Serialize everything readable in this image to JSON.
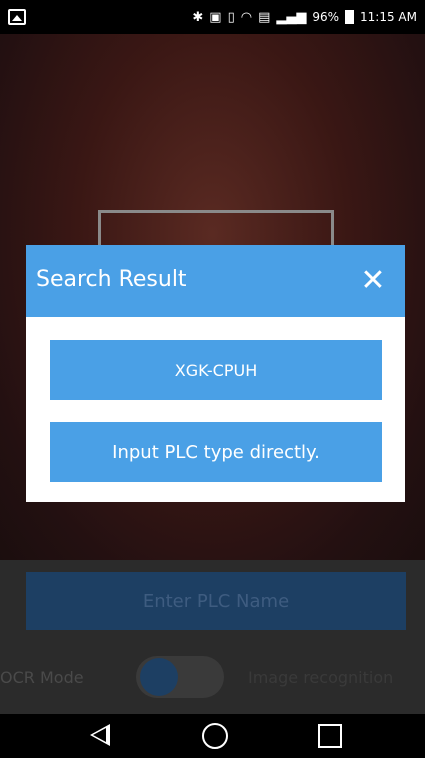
{
  "status_bar": {
    "battery": "96%",
    "time": "11:15 AM",
    "icons": [
      "gallery-icon",
      "bluetooth-icon",
      "nfc-icon",
      "vibrate-icon",
      "wifi-icon",
      "sim-icon",
      "signal-icon",
      "battery-icon"
    ]
  },
  "dialog": {
    "title": "Search Result",
    "close_icon": "close-icon",
    "results": [
      "XGK-CPUH",
      "Input PLC type directly."
    ]
  },
  "background": {
    "enter_button": "Enter PLC Name",
    "ocr_label": "OCR Mode",
    "image_label": "Image recognition"
  },
  "nav_bar": {
    "icons": [
      "back-icon",
      "home-icon",
      "recent-apps-icon"
    ]
  },
  "colors": {
    "accent": "#4aa0e6",
    "dim_button": "#1d3f63"
  }
}
